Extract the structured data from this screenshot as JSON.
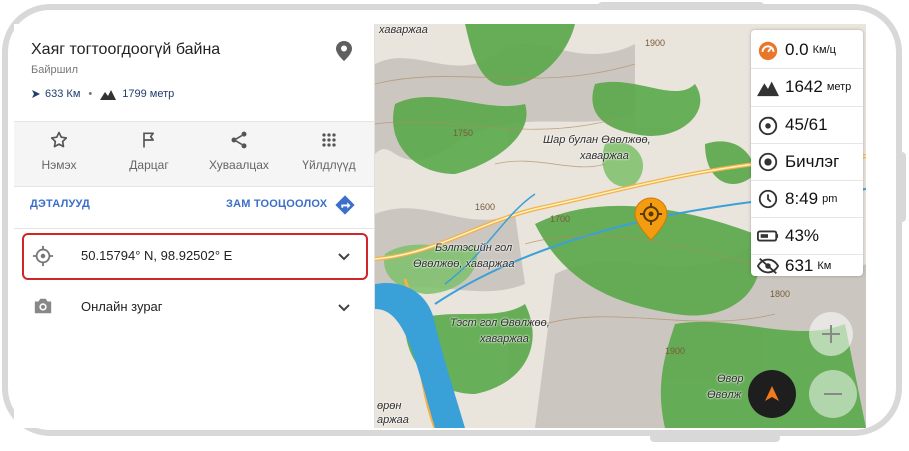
{
  "place": {
    "title": "Хаяг тогтоогдоогүй байна",
    "subtitle": "Байршил",
    "distance": "633 Км",
    "separator": "•",
    "altitude": "1799 метр"
  },
  "actions": [
    {
      "label": "Нэмэх",
      "icon": "star-icon"
    },
    {
      "label": "Дарцаг",
      "icon": "flag-icon"
    },
    {
      "label": "Хуваалцах",
      "icon": "share-icon"
    },
    {
      "label": "Үйлдлүүд",
      "icon": "more-grid-icon"
    }
  ],
  "links": {
    "details": "ДЭТАЛУУД",
    "route": "ЗАМ ТООЦООЛОХ"
  },
  "coordinates": {
    "value": "50.15794° N, 98.92502° E"
  },
  "photo": {
    "label": "Онлайн зураг"
  },
  "widgets": {
    "speed": {
      "value": "0.0",
      "unit": "Км/ц"
    },
    "altitude": {
      "value": "1642",
      "unit": "метр"
    },
    "satellites": {
      "value": "45/61"
    },
    "track": {
      "value": "Бичлэг"
    },
    "time": {
      "value": "8:49",
      "unit": "pm"
    },
    "battery": {
      "value": "43%"
    },
    "distance": {
      "value": "631",
      "unit": "Км"
    }
  },
  "map_labels": {
    "label1": "Шар булан Өвөлжөө,",
    "label1b": "хаваржаа",
    "label2": "Бэлтэсийн гол",
    "label2b": "Өвөлжөө, хаваржаа",
    "label3": "Тэст гол Өвөлжөө,",
    "label3b": "хаваржаа",
    "label4": "Өвөр",
    "label4b": "Өвөлж",
    "label5": "хаваржаа",
    "label6": "өрөн",
    "label6b": "аржаа",
    "c1": "1900",
    "c2": "1750",
    "c3": "1600",
    "c4": "1700",
    "c5": "1900",
    "c6": "1800"
  },
  "colors": {
    "accent": "#3b6fc9",
    "highlight": "#d0262a",
    "poi": "#f39c12",
    "forest": "#5aa84a",
    "water": "#3aa0d8"
  }
}
